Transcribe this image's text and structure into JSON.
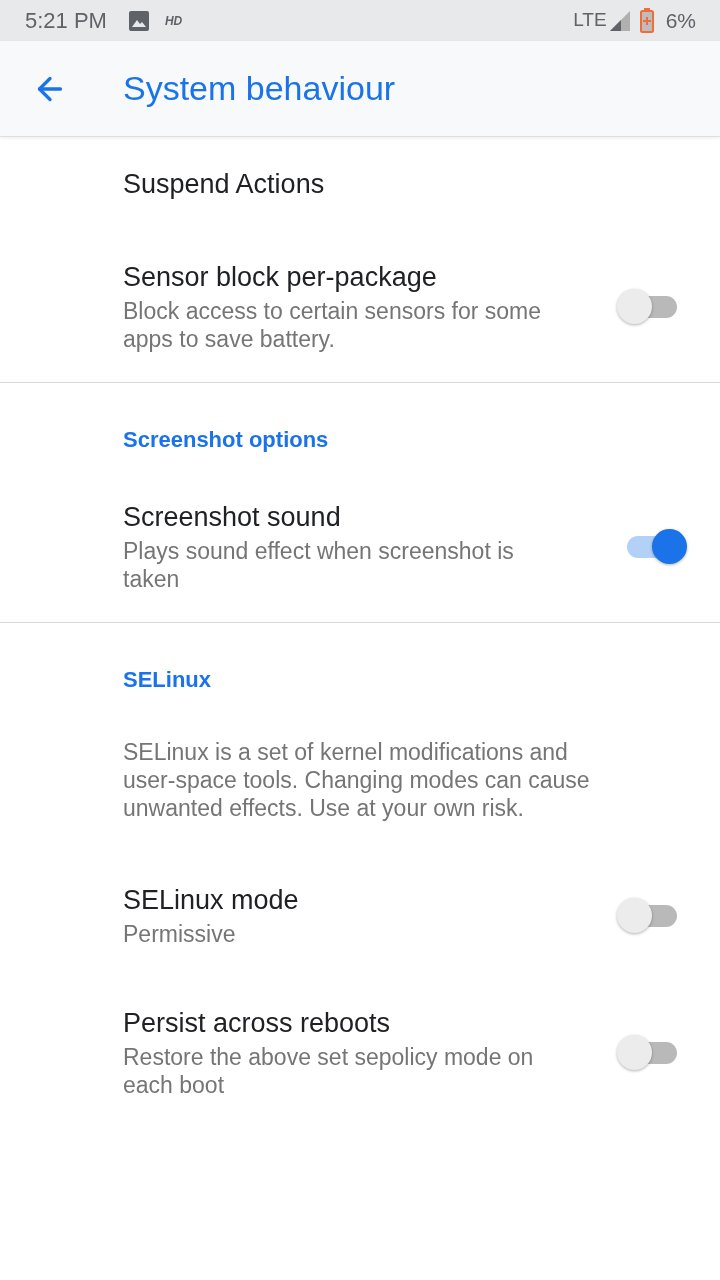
{
  "status_bar": {
    "time": "5:21 PM",
    "hd_badge": "HD",
    "network": "LTE",
    "battery": "6%"
  },
  "app_bar": {
    "title": "System behaviour"
  },
  "sections": [
    {
      "items": [
        {
          "kind": "action",
          "title": "Suspend Actions"
        },
        {
          "kind": "switch",
          "title": "Sensor block per-package",
          "summary": "Block access to certain sensors for some apps to save battery.",
          "on": false
        }
      ]
    },
    {
      "header": "Screenshot options",
      "items": [
        {
          "kind": "switch",
          "title": "Screenshot sound",
          "summary": "Plays sound effect when screenshot is taken",
          "on": true
        }
      ]
    },
    {
      "header": "SELinux",
      "items": [
        {
          "kind": "note",
          "text": "SELinux is a set of kernel modifications and user-space tools. Changing modes can cause unwanted effects. Use at your own risk."
        },
        {
          "kind": "switch",
          "title": "SELinux mode",
          "summary": "Permissive",
          "on": false
        },
        {
          "kind": "switch",
          "title": "Persist across reboots",
          "summary": "Restore the above set sepolicy mode on each boot",
          "on": false
        }
      ]
    }
  ]
}
